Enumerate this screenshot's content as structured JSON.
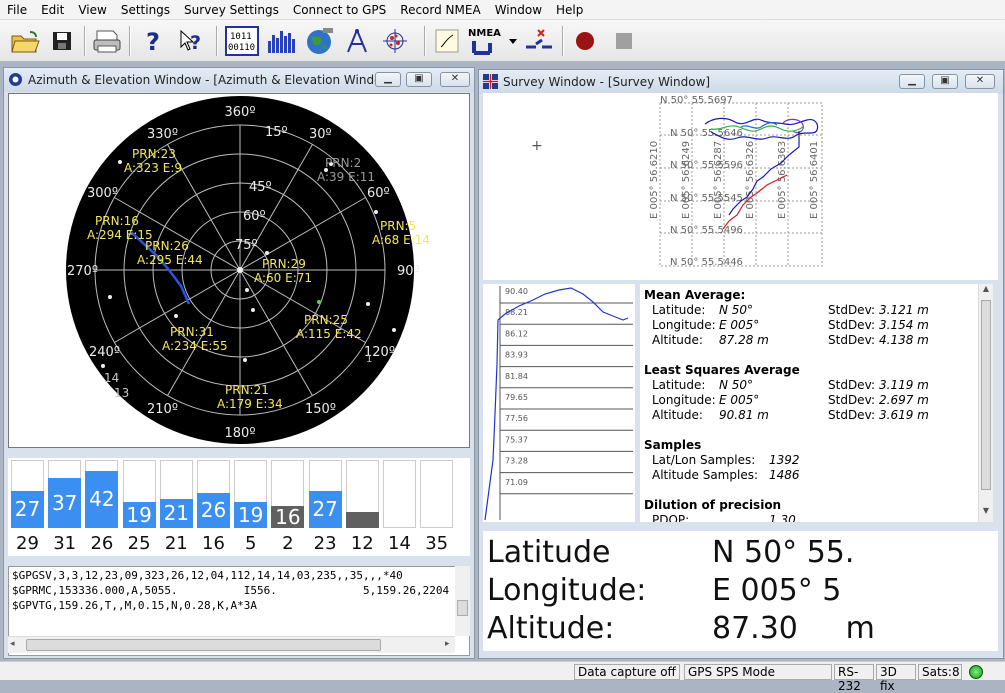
{
  "menu": [
    "File",
    "Edit",
    "View",
    "Settings",
    "Survey Settings",
    "Connect to GPS",
    "Record NMEA",
    "Window",
    "Help"
  ],
  "toolbar": {
    "nmea_label": "NMEA",
    "bin_row1": "1011",
    "bin_row2": "00110"
  },
  "az_window": {
    "title": "Azimuth & Elevation Window - [Azimuth & Elevation Window]",
    "ring_labels": [
      "75º",
      "60º",
      "45º",
      "15º"
    ],
    "az_labels": {
      "n": "360º",
      "e": "90º",
      "s": "180º",
      "w": "270º",
      "a15": "15º",
      "a30": "30º",
      "a60": "60º",
      "a120": "120º",
      "a150": "150º",
      "a210": "210º",
      "a240": "240º",
      "a300": "300º",
      "a330": "330º"
    },
    "sats": [
      {
        "prn": "PRN:23",
        "ae": "A:323 E:9",
        "color": "#f2e85a"
      },
      {
        "prn": "PRN:2",
        "ae": "A:39 E:11",
        "color": "#9a9a9a"
      },
      {
        "prn": "PRN:16",
        "ae": "A:294 E:15",
        "color": "#f2e85a"
      },
      {
        "prn": "PRN:5",
        "ae": "A:68 E:14",
        "color": "#f2e85a"
      },
      {
        "prn": "PRN:26",
        "ae": "A:295 E:44",
        "color": "#f2e85a"
      },
      {
        "prn": "PRN:29",
        "ae": "A:60 E:71",
        "color": "#f2e85a"
      },
      {
        "prn": "PRN:31",
        "ae": "A:234 E:55",
        "color": "#f2e85a"
      },
      {
        "prn": "PRN:25",
        "ae": "A:115 E:42",
        "color": "#f2e85a"
      },
      {
        "prn": "PRN:21",
        "ae": "A:179 E:34",
        "color": "#f2e85a"
      }
    ],
    "faint": [
      "14",
      "13"
    ]
  },
  "snr": [
    {
      "prn": "29",
      "snr": "27",
      "level": 27,
      "grey": false
    },
    {
      "prn": "31",
      "snr": "37",
      "level": 37,
      "grey": false
    },
    {
      "prn": "26",
      "snr": "42",
      "level": 42,
      "grey": false
    },
    {
      "prn": "25",
      "snr": "19",
      "level": 19,
      "grey": false
    },
    {
      "prn": "21",
      "snr": "21",
      "level": 21,
      "grey": false
    },
    {
      "prn": "16",
      "snr": "26",
      "level": 26,
      "grey": false
    },
    {
      "prn": "5",
      "snr": "19",
      "level": 19,
      "grey": false
    },
    {
      "prn": "2",
      "snr": "16",
      "level": 16,
      "grey": true
    },
    {
      "prn": "23",
      "snr": "27",
      "level": 27,
      "grey": false
    },
    {
      "prn": "12",
      "snr": "",
      "level": 12,
      "grey": true
    },
    {
      "prn": "14",
      "snr": "",
      "level": 0,
      "grey": false
    },
    {
      "prn": "35",
      "snr": "",
      "level": 0,
      "grey": false
    }
  ],
  "nmea_lines": [
    "$GPGSV,3,3,12,23,09,323,26,12,04,112,14,14,03,235,,35,,,*40",
    "$GPRMC,153336.000,A,5055.          I556.             5,159.26,2204",
    "$GPVTG,159.26,T,,M,0.15,N,0.28,K,A*3A"
  ],
  "survey": {
    "title": "Survey Window - [Survey Window]",
    "lat_grid": [
      "N 50° 55.5697",
      "N 50° 55.5646",
      "N 50° 55.5596",
      "N 50° 55.5545",
      "N 50° 55.5496",
      "N 50° 55.5446"
    ],
    "lon_grid": [
      "E 005° 56.6210",
      "E 005° 56.6249",
      "E 005° 56.6287",
      "E 005° 56.6326",
      "E 005° 56.6363",
      "E 005° 56.6401"
    ]
  },
  "alt_ticks": [
    "90.40",
    "88.21",
    "86.12",
    "83.93",
    "81.84",
    "79.65",
    "77.56",
    "75.37",
    "73.28",
    "71.09"
  ],
  "stats": {
    "mean_h": "Mean Average:",
    "lat_l": "Latitude:",
    "lat_v": "N 50°",
    "lat_sdl": "StdDev:",
    "lat_sd": "3.121 m",
    "lon_l": "Longitude:",
    "lon_v": "E 005°",
    "lon_sdl": "StdDev:",
    "lon_sd": "3.154 m",
    "alt_l": "Altitude:",
    "alt_v": "87.28   m",
    "alt_sdl": "StdDev:",
    "alt_sd": "4.138 m",
    "ls_h": "Least Squares Average",
    "ls_lat_l": "Latitude:",
    "ls_lat_v": "N 50°",
    "ls_lat_sdl": "StdDev:",
    "ls_lat_sd": "3.119 m",
    "ls_lon_l": "Longitude:",
    "ls_lon_v": "E 005°",
    "ls_lon_sdl": "StdDev:",
    "ls_lon_sd": "2.697 m",
    "ls_alt_l": "Altitude:",
    "ls_alt_v": "90.81   m",
    "ls_alt_sdl": "StdDev:",
    "ls_alt_sd": "3.619 m",
    "samples_h": "Samples",
    "ll_l": "Lat/Lon Samples:",
    "ll_v": "1392",
    "as_l": "Altitude Samples:",
    "as_v": "1486",
    "dop_h": "Dilution of precision",
    "pdop_l": "PDOP:",
    "pdop_v": "1.30"
  },
  "big": {
    "lat_l": "Latitude",
    "lat_v": "N 50° 55.",
    "lon_l": "Longitude:",
    "lon_v": "E 005° 5",
    "alt_l": "Altitude:",
    "alt_v": "87.30     m"
  },
  "status": {
    "capture": "Data capture off",
    "mode": "GPS SPS Mode",
    "port": "RS-232",
    "fix": "3D fix",
    "sats": "Sats:8"
  }
}
